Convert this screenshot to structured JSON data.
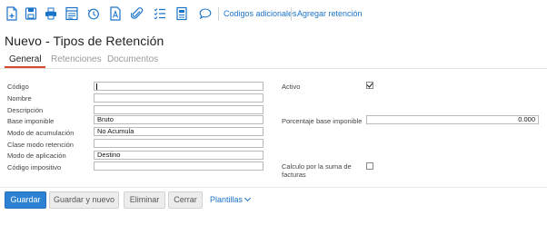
{
  "toolbar": {
    "icons": [
      "new-document-icon",
      "save-icon",
      "print-icon",
      "print-preview-icon",
      "history-icon",
      "text-document-icon",
      "attachment-icon",
      "checklist-icon",
      "report-icon",
      "comment-icon"
    ],
    "links": {
      "additional_codes": "Codigos adicionales",
      "add_retention": "Agregar retención"
    },
    "icon_color": "#1a73c9"
  },
  "page": {
    "title": "Nuevo - Tipos de Retención"
  },
  "tabs": [
    {
      "label": "General",
      "active": true
    },
    {
      "label": "Retenciones",
      "active": false
    },
    {
      "label": "Documentos",
      "active": false
    }
  ],
  "form": {
    "codigo": {
      "label": "Código",
      "value": ""
    },
    "nombre": {
      "label": "Nombre",
      "value": ""
    },
    "descripcion": {
      "label": "Descripción",
      "value": ""
    },
    "base_imponible": {
      "label": "Base imponible",
      "value": "Bruto"
    },
    "modo_acumulacion": {
      "label": "Modo de acumulación",
      "value": "No Acumula"
    },
    "clase_modo_retencion": {
      "label": "Clase modo retención",
      "value": ""
    },
    "modo_aplicacion": {
      "label": "Modo de aplicación",
      "value": "Destino"
    },
    "codigo_impositivo": {
      "label": "Código impositivo",
      "value": ""
    },
    "activo": {
      "label": "Activo",
      "checked": true
    },
    "porcentaje_base": {
      "label": "Porcentaje base imponible",
      "value": "0.000"
    },
    "calculo_suma": {
      "label": "Calculo por la suma de facturas",
      "checked": false
    }
  },
  "footer": {
    "save": "Guardar",
    "save_new": "Guardar y nuevo",
    "delete": "Eliminar",
    "close": "Cerrar",
    "templates": "Plantillas",
    "accent": "#2d81d3"
  }
}
